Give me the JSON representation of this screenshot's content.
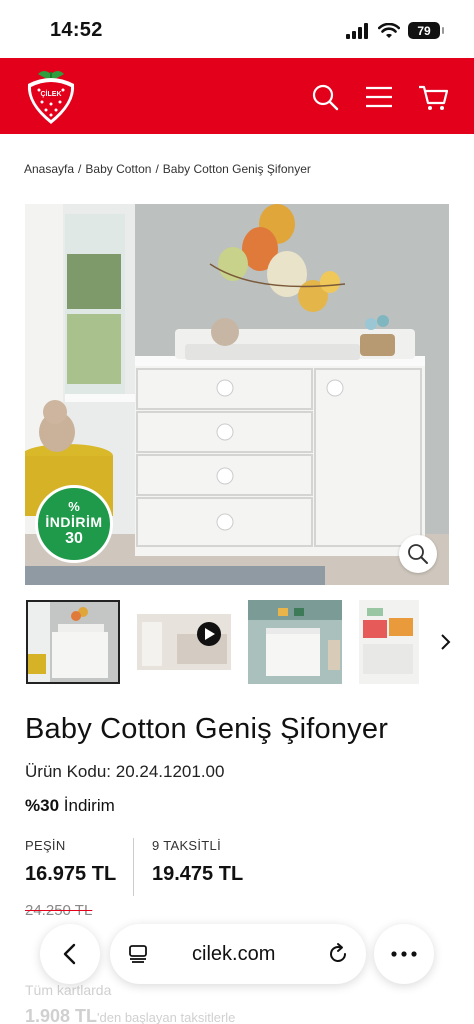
{
  "status_bar": {
    "time": "14:52",
    "battery": "79"
  },
  "header": {
    "brand_color": "#e3001b",
    "logo_text": "ÇİLEK"
  },
  "breadcrumb": {
    "items": [
      "Anasayfa",
      "Baby Cotton",
      "Baby Cotton Geniş Şifonyer"
    ],
    "separator": "/"
  },
  "product_image": {
    "badge": {
      "percent_sign": "%",
      "label": "İNDİRİM",
      "value": "30",
      "color": "#1e9a4a"
    }
  },
  "thumbnails": {
    "count": 4,
    "active_index": 0
  },
  "product": {
    "title": "Baby Cotton Geniş Şifonyer",
    "code_label": "Ürün Kodu:",
    "code_value": "20.24.1201.00",
    "discount_value": "%30",
    "discount_label": "İndirim"
  },
  "pricing": {
    "cash_label": "PEŞİN",
    "cash_price": "16.975 TL",
    "installment_label": "9 TAKSİTLİ",
    "installment_price": "19.475 TL",
    "old_price": "24.250 TL"
  },
  "lower": {
    "all_cards_label": "Tüm kartlarda",
    "installment_start": "1.908 TL",
    "installment_start_suffix": "'den başlayan taksitlerle"
  },
  "browser": {
    "url": "cilek.com"
  }
}
